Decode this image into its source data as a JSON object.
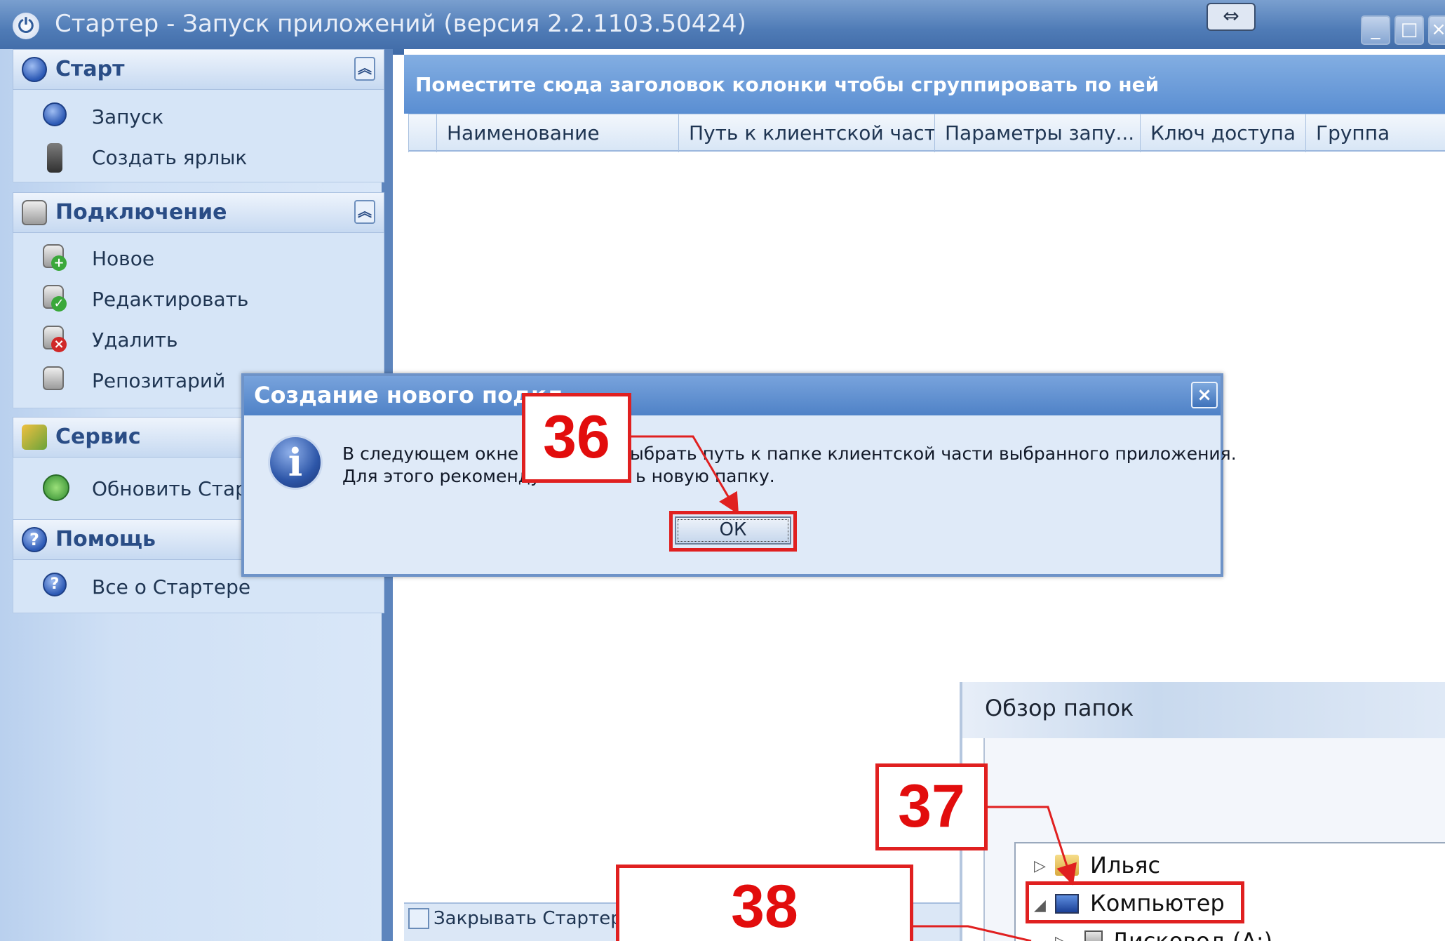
{
  "window": {
    "title": "Стартер - Запуск приложений (версия 2.2.1103.50424)",
    "minimize": "_",
    "maximize": "□",
    "close": "×",
    "resize_glyph": "⇔"
  },
  "sidebar": {
    "sections": [
      {
        "title": "Старт",
        "icon": "start-circle-icon",
        "items": [
          {
            "label": "Запуск",
            "icon": "run-circle-icon"
          },
          {
            "label": "Создать ярлык",
            "icon": "shortcut-icon"
          }
        ]
      },
      {
        "title": "Подключение",
        "icon": "database-icon",
        "items": [
          {
            "label": "Новое",
            "icon": "database-add-icon"
          },
          {
            "label": "Редактировать",
            "icon": "database-edit-icon"
          },
          {
            "label": "Удалить",
            "icon": "database-delete-icon"
          },
          {
            "label": "Репозитарий",
            "icon": "database-repo-icon"
          }
        ]
      },
      {
        "title": "Сервис",
        "icon": "service-tools-icon",
        "items": [
          {
            "label": "Обновить Старте",
            "icon": "refresh-icon"
          }
        ]
      },
      {
        "title": "Помощь",
        "icon": "help-circle-icon",
        "items": [
          {
            "label": "Все о Стартере",
            "icon": "help-icon"
          }
        ]
      }
    ]
  },
  "grid": {
    "group_prompt": "Поместите сюда заголовок колонки чтобы сгруппировать по ней",
    "columns": [
      "Наименование",
      "Путь к клиентской части",
      "Параметры запу...",
      "Ключ доступа",
      "Группа"
    ],
    "footer_checkbox_label": "Закрывать Стартер п",
    "footer_checkbox_checked": false
  },
  "dialog": {
    "title": "Создание нового подкл",
    "message_line1_a": "В следующем окне н",
    "message_line1_b": "ыбрать путь к папке клиентской части выбранного приложения.",
    "message_line2_a": "Для этого рекоменду",
    "message_line2_b": "ь новую папку.",
    "ok_label": "ОК",
    "close": "×",
    "icon": "info-icon"
  },
  "browse_dialog": {
    "title": "Обзор папок",
    "tree": [
      {
        "label": "Ильяс",
        "icon": "user-folder-icon",
        "expanded": false
      },
      {
        "label": "Компьютер",
        "icon": "computer-icon",
        "expanded": true
      },
      {
        "label": "Дисковод (A:)",
        "icon": "floppy-drive-icon",
        "expanded": false
      }
    ]
  },
  "annotations": {
    "steps": [
      "36",
      "37",
      "38"
    ],
    "color": "#e02020"
  }
}
